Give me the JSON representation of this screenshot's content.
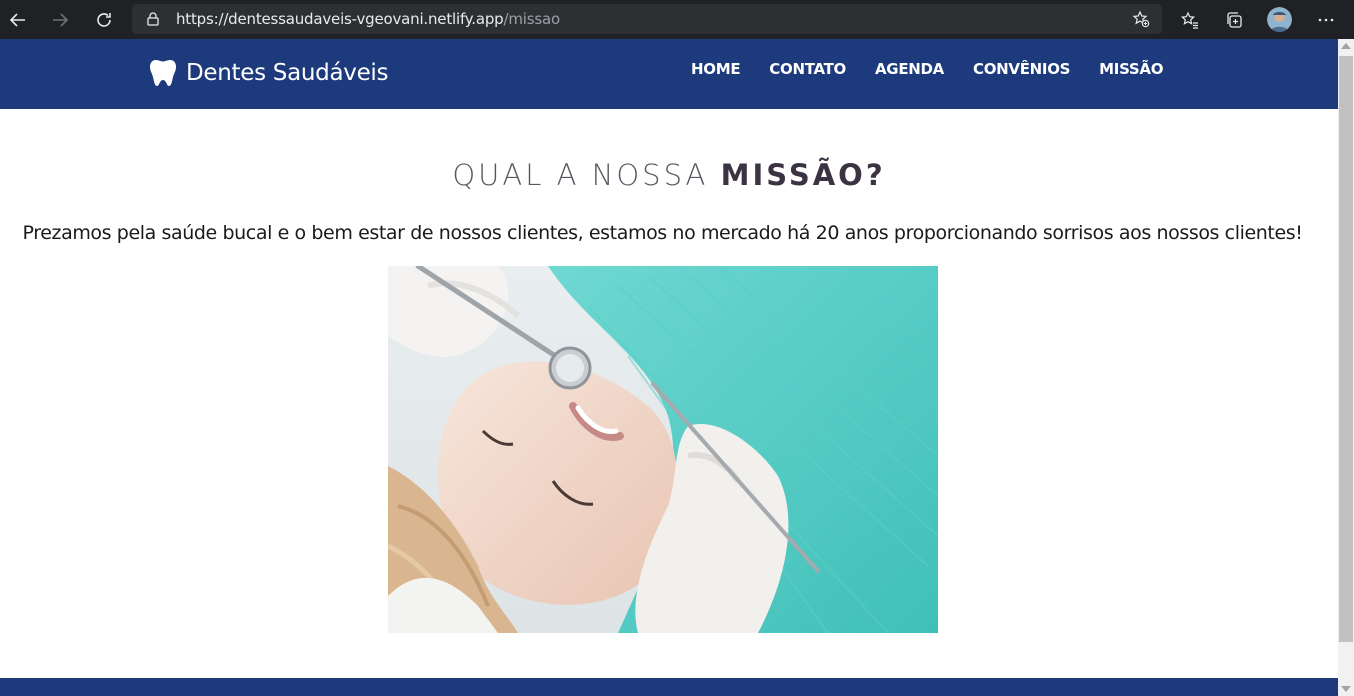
{
  "browser": {
    "url_base": "https://dentessaudaveis-vgeovani.netlify.app",
    "url_path": "/missao"
  },
  "site": {
    "brand_name": "Dentes Saudáveis",
    "nav": [
      "HOME",
      "CONTATO",
      "AGENDA",
      "CONVÊNIOS",
      "MISSÃO"
    ]
  },
  "main": {
    "heading_light": "QUAL A NOSSA ",
    "heading_bold": "MISSÃO?",
    "description": "Prezamos pela saúde bucal e o bem estar de nossos clientes, estamos no mercado há 20 anos proporcionando sorrisos aos nossos clientes!"
  },
  "colors": {
    "navbar": "#1d3a7c",
    "browser_chrome": "#202124"
  },
  "icons": {
    "brand": "tooth-icon"
  }
}
